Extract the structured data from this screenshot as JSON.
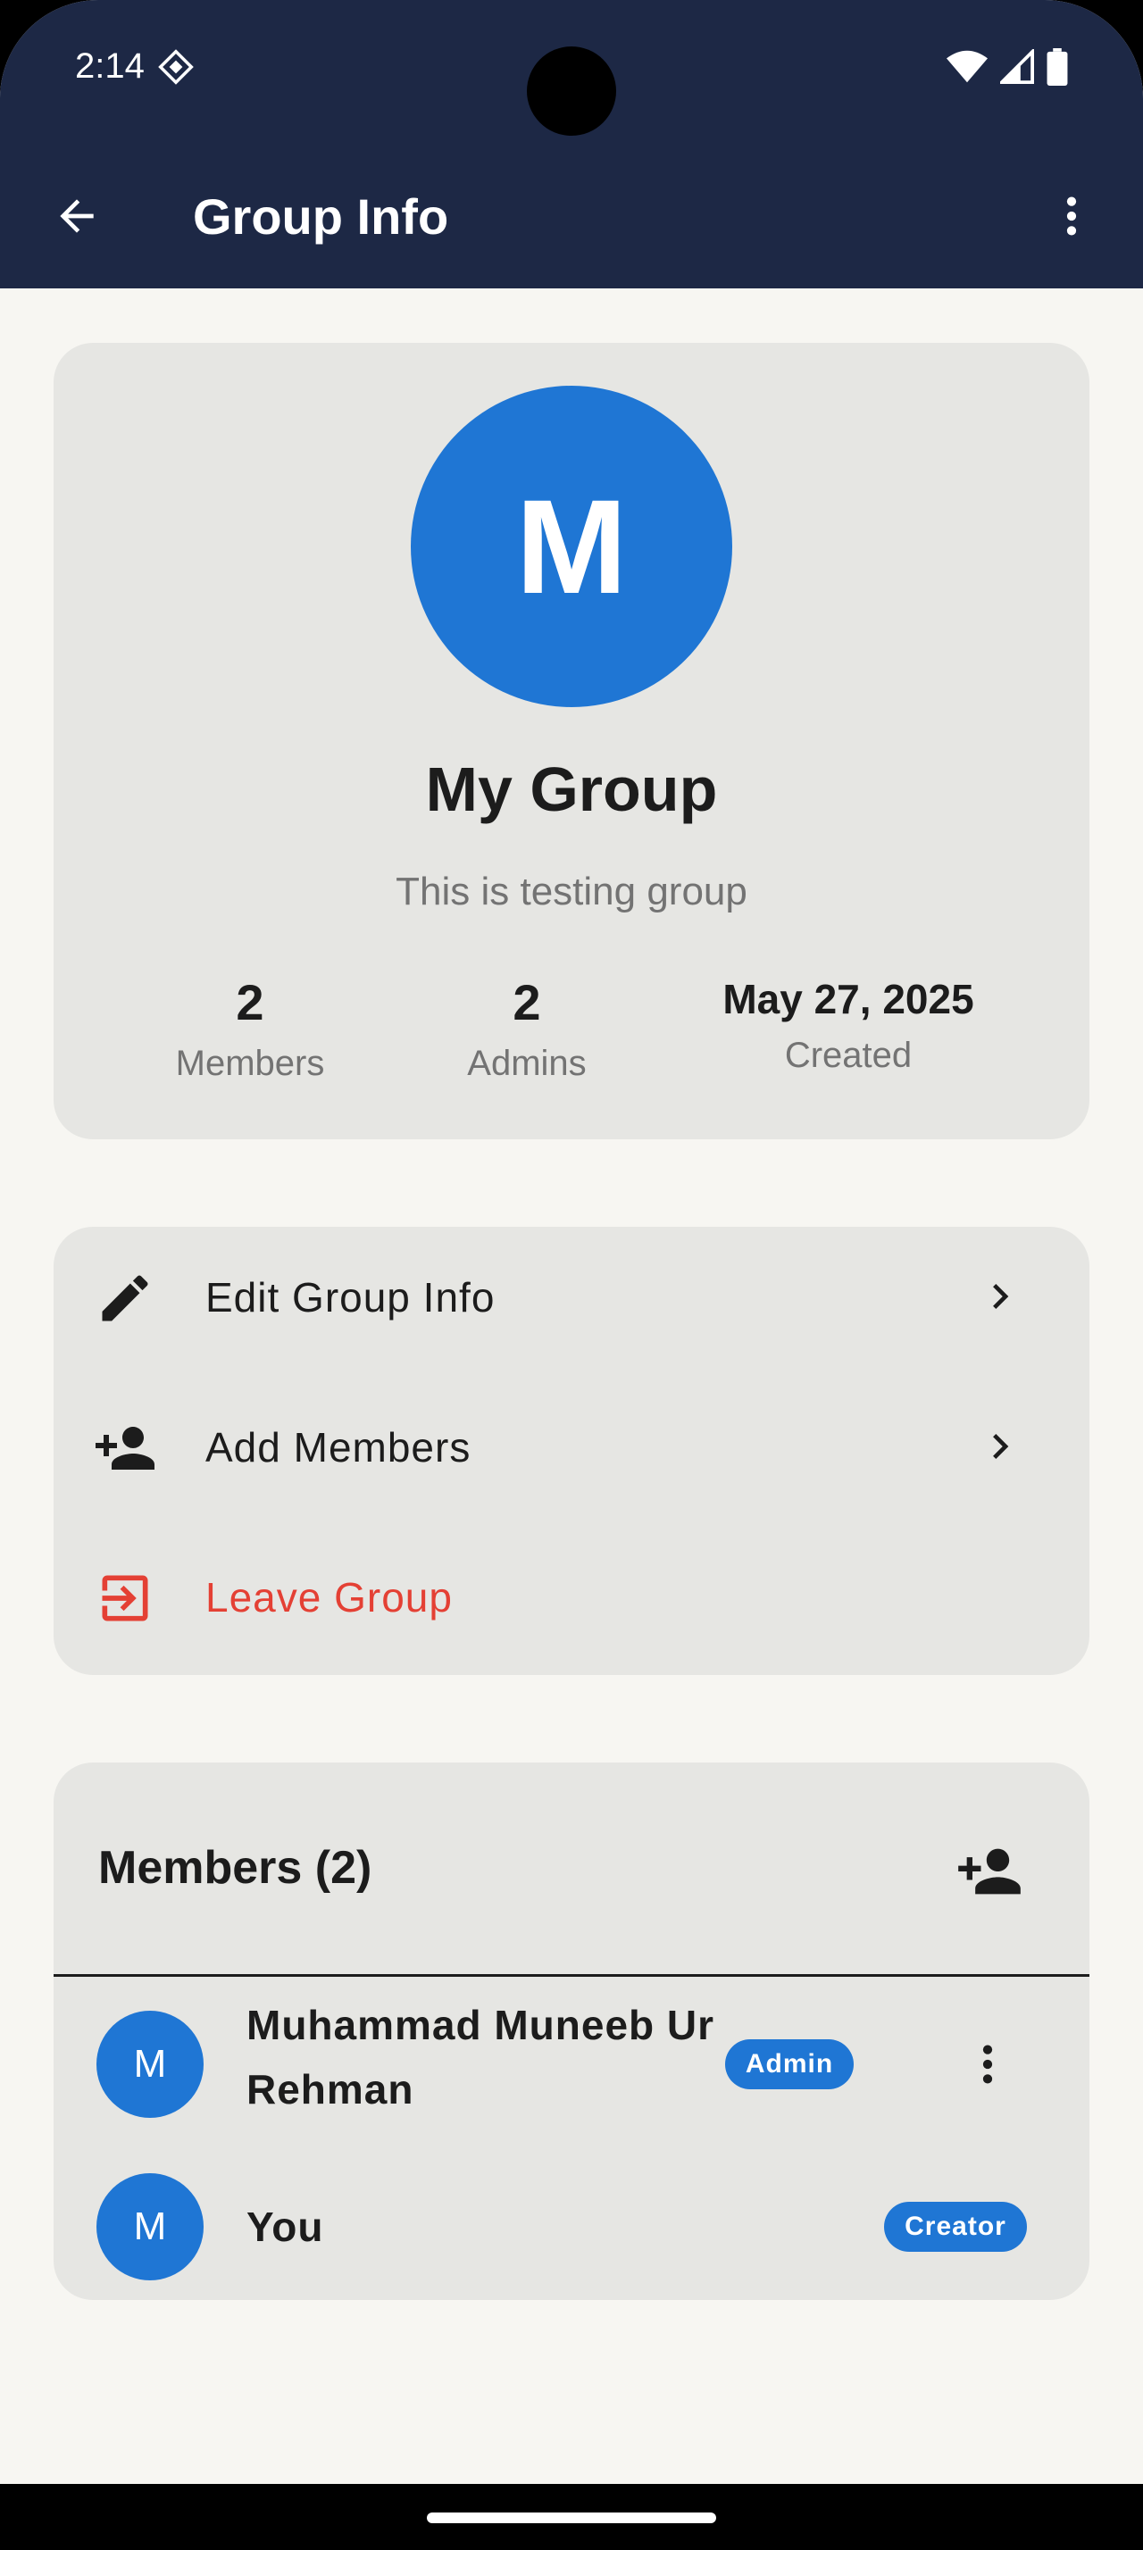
{
  "status_bar": {
    "time": "2:14"
  },
  "app_bar": {
    "title": "Group Info"
  },
  "group": {
    "avatar_letter": "M",
    "name": "My Group",
    "description": "This is testing group",
    "stats": [
      {
        "value": "2",
        "label": "Members"
      },
      {
        "value": "2",
        "label": "Admins"
      },
      {
        "value": "May 27, 2025",
        "label": "Created"
      }
    ]
  },
  "actions": [
    {
      "label": "Edit Group Info",
      "icon": "pencil-icon"
    },
    {
      "label": "Add Members",
      "icon": "person-add-icon"
    },
    {
      "label": "Leave Group",
      "icon": "exit-icon"
    }
  ],
  "members_section": {
    "title": "Members (2)",
    "members": [
      {
        "avatar_letter": "M",
        "name_line1": "Muhammad Muneeb Ur",
        "name_line2": "Rehman",
        "role": "Admin"
      },
      {
        "avatar_letter": "M",
        "name_line1": "You",
        "role": "Creator"
      }
    ]
  },
  "colors": {
    "app_bar": "#1d2845",
    "accent": "#1f76d4",
    "danger": "#e44034",
    "card": "#e6e6e3",
    "background": "#f7f6f2"
  }
}
